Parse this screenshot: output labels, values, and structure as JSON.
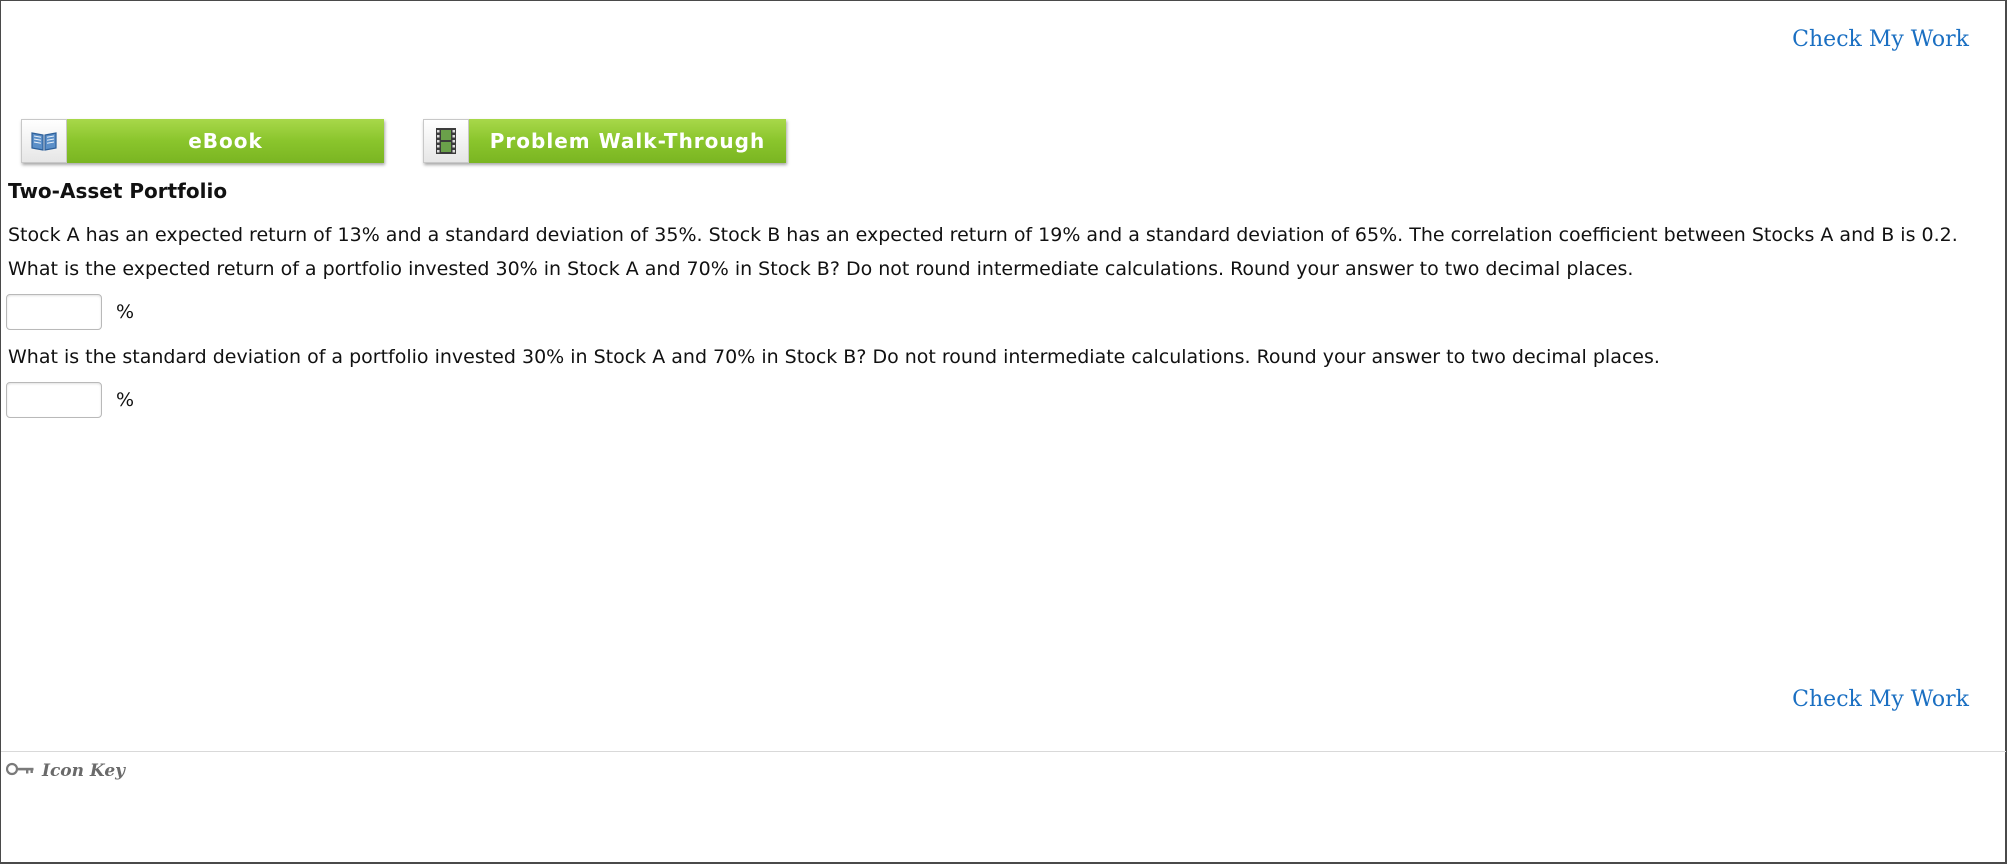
{
  "header": {
    "check_my_work": "Check My Work"
  },
  "toolbar": {
    "ebook_label": "eBook",
    "ebook_icon": "open-book-icon",
    "walkthrough_label": "Problem Walk-Through",
    "walkthrough_icon": "film-strip-icon",
    "accent": "#8ac52c"
  },
  "problem": {
    "title": "Two-Asset Portfolio",
    "statement": "Stock A has an expected return of 13% and a standard deviation of 35%. Stock B has an expected return of 19% and a standard deviation of 65%. The correlation coefficient between Stocks A and B is 0.2.",
    "question1": "What is the expected return of a portfolio invested 30% in Stock A and 70% in Stock B? Do not round intermediate calculations. Round your answer to two decimal places.",
    "answer1_value": "",
    "answer1_unit": "%",
    "question2": "What is the standard deviation of a portfolio invested 30% in Stock A and 70% in Stock B? Do not round intermediate calculations. Round your answer to two decimal places.",
    "answer2_value": "",
    "answer2_unit": "%"
  },
  "footer": {
    "check_my_work": "Check My Work",
    "icon_key_label": "Icon Key",
    "icon_key_icon": "key-icon"
  },
  "colors": {
    "link": "#1a6fc2",
    "button_green": "#8ac52c"
  }
}
